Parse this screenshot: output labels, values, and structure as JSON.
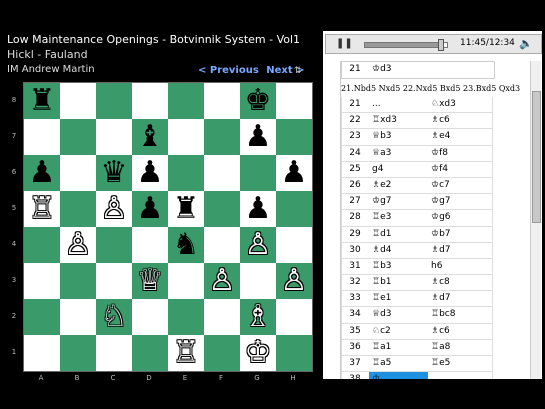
{
  "header": {
    "title": "Low Maintenance Openings - Botvinnik System - Vol1",
    "players": "Hickl - Fauland",
    "author": "IM Andrew Martin",
    "prev_label": "< Previous",
    "next_label": "Next >"
  },
  "board": {
    "files": [
      "A",
      "B",
      "C",
      "D",
      "E",
      "F",
      "G",
      "H"
    ],
    "ranks": [
      "8",
      "7",
      "6",
      "5",
      "4",
      "3",
      "2",
      "1"
    ],
    "pieces": [
      {
        "sq": "a8",
        "glyph": "♜",
        "color": "b",
        "name": "black-rook"
      },
      {
        "sq": "g8",
        "glyph": "♚",
        "color": "b",
        "name": "black-king"
      },
      {
        "sq": "d7",
        "glyph": "♝",
        "color": "b",
        "name": "black-bishop"
      },
      {
        "sq": "g7",
        "glyph": "♟",
        "color": "b",
        "name": "black-pawn"
      },
      {
        "sq": "a6",
        "glyph": "♟",
        "color": "b",
        "name": "black-pawn"
      },
      {
        "sq": "c6",
        "glyph": "♛",
        "color": "b",
        "name": "black-queen"
      },
      {
        "sq": "d6",
        "glyph": "♟",
        "color": "b",
        "name": "black-pawn"
      },
      {
        "sq": "h6",
        "glyph": "♟",
        "color": "b",
        "name": "black-pawn"
      },
      {
        "sq": "a5",
        "glyph": "♖",
        "color": "w",
        "name": "white-rook"
      },
      {
        "sq": "c5",
        "glyph": "♙",
        "color": "w",
        "name": "white-pawn"
      },
      {
        "sq": "d5",
        "glyph": "♟",
        "color": "b",
        "name": "black-pawn"
      },
      {
        "sq": "e5",
        "glyph": "♜",
        "color": "b",
        "name": "black-rook"
      },
      {
        "sq": "g5",
        "glyph": "♟",
        "color": "b",
        "name": "black-pawn"
      },
      {
        "sq": "b4",
        "glyph": "♙",
        "color": "w",
        "name": "white-pawn"
      },
      {
        "sq": "e4",
        "glyph": "♞",
        "color": "b",
        "name": "black-knight"
      },
      {
        "sq": "g4",
        "glyph": "♙",
        "color": "w",
        "name": "white-pawn"
      },
      {
        "sq": "d3",
        "glyph": "♕",
        "color": "w",
        "name": "white-queen"
      },
      {
        "sq": "f3",
        "glyph": "♙",
        "color": "w",
        "name": "white-pawn"
      },
      {
        "sq": "h3",
        "glyph": "♙",
        "color": "w",
        "name": "white-pawn"
      },
      {
        "sq": "c2",
        "glyph": "♘",
        "color": "w",
        "name": "white-knight"
      },
      {
        "sq": "g2",
        "glyph": "♗",
        "color": "w",
        "name": "white-bishop"
      },
      {
        "sq": "e1",
        "glyph": "♖",
        "color": "w",
        "name": "white-rook"
      },
      {
        "sq": "g1",
        "glyph": "♔",
        "color": "w",
        "name": "white-king"
      }
    ]
  },
  "player": {
    "time": "11:45/12:34",
    "progress": 0.93,
    "pause_icon": "pause-icon",
    "mute_icon": "speaker-icon"
  },
  "moves": {
    "first": {
      "num": "21",
      "white": "♔d3",
      "black": ""
    },
    "comment": "21.Nbd5 Nxd5 22.Nxd5 Bxd5 23.Bxd5 Qxd3",
    "rows": [
      {
        "num": "21",
        "white": "...",
        "black": "♘xd3",
        "hl": false
      },
      {
        "num": "22",
        "white": "♖xd3",
        "black": "♗c6",
        "hl": false
      },
      {
        "num": "23",
        "white": "♕b3",
        "black": "♗e4",
        "hl": false
      },
      {
        "num": "24",
        "white": "♕a3",
        "black": "♔f8",
        "hl": false
      },
      {
        "num": "25",
        "white": "g4",
        "black": "♔f4",
        "hl": false
      },
      {
        "num": "26",
        "white": "♗e2",
        "black": "♔c7",
        "hl": false
      },
      {
        "num": "27",
        "white": "♔g7",
        "black": "♔g7",
        "hl": false
      },
      {
        "num": "28",
        "white": "♖e3",
        "black": "♔g6",
        "hl": false
      },
      {
        "num": "29",
        "white": "♖d1",
        "black": "♔b7",
        "hl": false
      },
      {
        "num": "30",
        "white": "♗d4",
        "black": "♗d7",
        "hl": false
      },
      {
        "num": "31",
        "white": "♖b3",
        "black": "h6",
        "hl": false
      },
      {
        "num": "32",
        "white": "♖b1",
        "black": "♗c8",
        "hl": false
      },
      {
        "num": "33",
        "white": "♖e1",
        "black": "♗d7",
        "hl": false
      },
      {
        "num": "34",
        "white": "♕d3",
        "black": "♖bc8",
        "hl": false
      },
      {
        "num": "35",
        "white": "♘c2",
        "black": "♗c6",
        "hl": false
      },
      {
        "num": "36",
        "white": "♖a1",
        "black": "♖a8",
        "hl": false
      },
      {
        "num": "37",
        "white": "♖a5",
        "black": "♖e5",
        "hl": false
      },
      {
        "num": "38",
        "white": "♔",
        "black": "",
        "hl": true
      }
    ],
    "scroll_position": 0.55
  }
}
